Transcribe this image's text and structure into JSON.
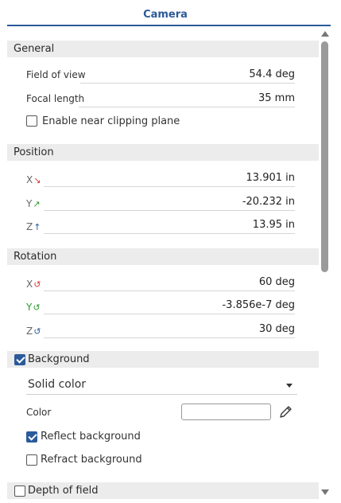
{
  "panel": {
    "title": "Camera"
  },
  "general": {
    "header": "General",
    "field_of_view": {
      "label": "Field of view",
      "value": "54.4 deg"
    },
    "focal_length": {
      "label": "Focal length",
      "value": "35 mm"
    },
    "near_clipping": {
      "label": "Enable near clipping plane",
      "checked": false
    }
  },
  "position": {
    "header": "Position",
    "x": {
      "axis": "X",
      "value": "13.901 in"
    },
    "y": {
      "axis": "Y",
      "value": "-20.232 in"
    },
    "z": {
      "axis": "Z",
      "value": "13.95 in"
    }
  },
  "rotation": {
    "header": "Rotation",
    "x": {
      "axis": "X",
      "value": "60 deg"
    },
    "y": {
      "axis": "Y",
      "value": "-3.856e-7 deg"
    },
    "z": {
      "axis": "Z",
      "value": "30 deg"
    }
  },
  "background": {
    "header": "Background",
    "checked": true,
    "type": "Solid color",
    "color_label": "Color",
    "reflect": {
      "label": "Reflect background",
      "checked": true
    },
    "refract": {
      "label": "Refract background",
      "checked": false
    }
  },
  "depth_of_field": {
    "label": "Depth of field",
    "checked": false
  },
  "colors": {
    "accent": "#2b5a9a",
    "axis_x": "#d9363e",
    "axis_y": "#2e9a2e",
    "axis_z": "#2b5a9a"
  },
  "icons": {
    "pencil": "pencil-icon",
    "dropdown": "chevron-down-icon"
  }
}
